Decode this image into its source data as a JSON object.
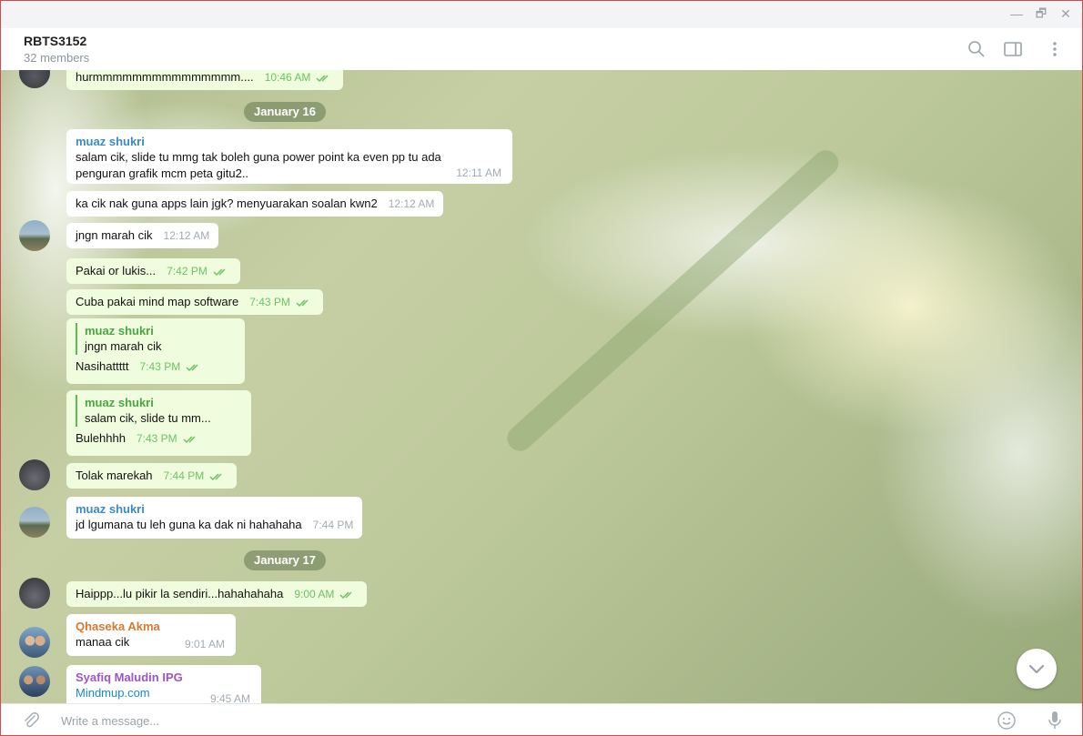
{
  "window": {
    "minimize_glyph": "—",
    "maximize_glyph": "🗗",
    "close_glyph": "✕"
  },
  "header": {
    "title": "RBTS3152",
    "subtitle": "32 members",
    "icons": [
      "search-icon",
      "sidebar-toggle-icon",
      "more-vertical-icon"
    ]
  },
  "colors": {
    "accent": "#168acd",
    "sender_blue": "#3a8bc4",
    "sender_orange": "#d8772f",
    "sender_purple": "#9b55c9",
    "out_bubble": "#effdde",
    "check_green": "#6cc264"
  },
  "dates": [
    "January 16",
    "January 17"
  ],
  "messages": [
    {
      "dir": "out",
      "text": "hurmmmmmmmmmmmmmmm....",
      "time": "10:46 AM",
      "read": true
    },
    {
      "dir": "in",
      "sender": "muaz shukri",
      "text": "salam cik, slide tu mmg tak boleh guna power point ka even pp tu ada penguran grafik mcm peta gitu2..",
      "time": "12:11 AM"
    },
    {
      "dir": "in",
      "text": "ka cik nak guna apps lain jgk? menyuarakan soalan kwn2",
      "time": "12:12 AM"
    },
    {
      "dir": "in",
      "text": "jngn marah cik",
      "time": "12:12 AM"
    },
    {
      "dir": "out",
      "text": "Pakai or lukis...",
      "time": "7:42 PM",
      "read": true
    },
    {
      "dir": "out",
      "text": "Cuba pakai mind map software",
      "time": "7:43 PM",
      "read": true
    },
    {
      "dir": "out",
      "reply_sender": "muaz shukri",
      "reply_text": "jngn marah cik",
      "text": "Nasihattttt",
      "time": "7:43 PM",
      "read": true
    },
    {
      "dir": "out",
      "reply_sender": "muaz shukri",
      "reply_text": "salam cik, slide tu mm...",
      "text": "Bulehhhh",
      "time": "7:43 PM",
      "read": true
    },
    {
      "dir": "out",
      "text": "Tolak marekah",
      "time": "7:44 PM",
      "read": true
    },
    {
      "dir": "in",
      "sender": "muaz shukri",
      "text": "jd lgumana tu leh guna ka dak ni hahahaha",
      "time": "7:44 PM"
    },
    {
      "dir": "out",
      "text": "Haippp...lu pikir la sendiri...hahahahaha",
      "time": "9:00 AM",
      "read": true
    },
    {
      "dir": "in",
      "sender": "Qhaseka Akma",
      "text": "manaa cik",
      "time": "9:01 AM"
    },
    {
      "dir": "in",
      "sender": "Syafiq Maludin IPG",
      "text": "Mindmup.com",
      "time": "9:45 AM",
      "is_link": true
    }
  ],
  "composer": {
    "placeholder": "Write a message...",
    "icons": [
      "attach-icon",
      "emoji-icon",
      "microphone-icon"
    ]
  }
}
